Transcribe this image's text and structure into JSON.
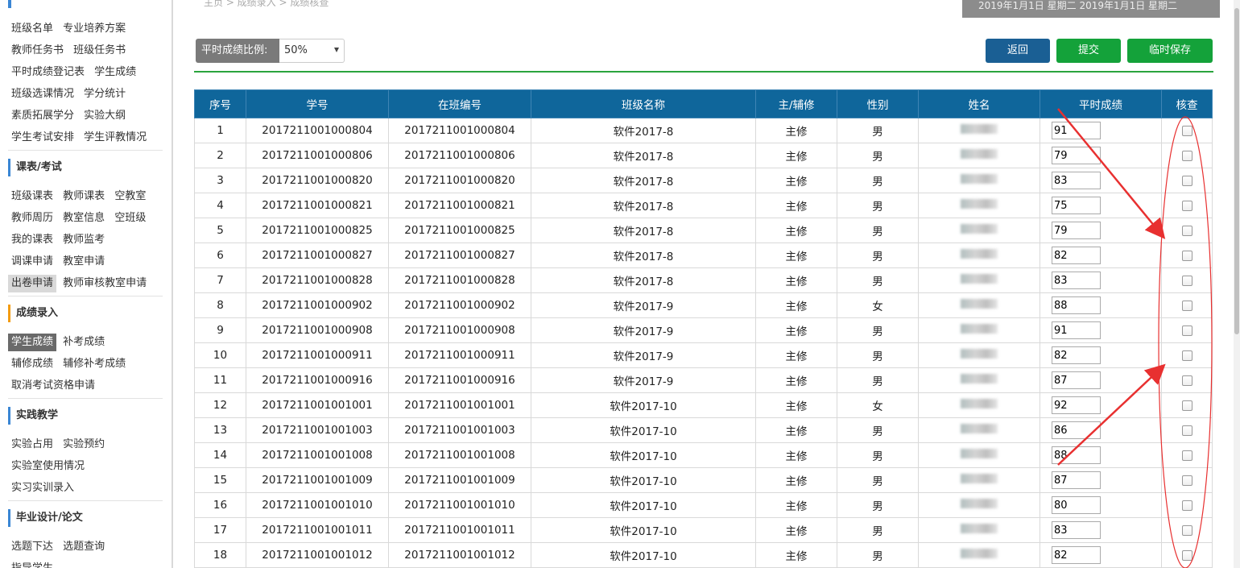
{
  "breadcrumb": "主页 > 成绩录入 > 成绩核查",
  "date_banner": "2019年1月1日 星期二 2019年1月1日 星期二",
  "sidebar": {
    "rows_a": [
      [
        "班级名单",
        "专业培养方案"
      ],
      [
        "教师任务书",
        "班级任务书"
      ],
      [
        "平时成绩登记表",
        "学生成绩"
      ],
      [
        "班级选课情况",
        "学分统计"
      ],
      [
        "素质拓展学分",
        "实验大纲"
      ],
      [
        "学生考试安排",
        "学生评教情况"
      ]
    ],
    "sec_schedule": "课表/考试",
    "rows_b": [
      [
        "班级课表",
        "教师课表",
        "空教室"
      ],
      [
        "教师周历",
        "教室信息",
        "空班级"
      ],
      [
        "我的课表",
        "教师监考"
      ],
      [
        "调课申请",
        "教室申请"
      ],
      [
        "出卷申请",
        "教师审核教室申请"
      ]
    ],
    "sec_grades": "成绩录入",
    "rows_c": [
      [
        "学生成绩",
        "补考成绩"
      ],
      [
        "辅修成绩",
        "辅修补考成绩"
      ],
      [
        "取消考试资格申请"
      ]
    ],
    "sec_practice": "实践教学",
    "rows_d": [
      [
        "实验占用",
        "实验预约"
      ],
      [
        "实验室使用情况"
      ],
      [
        "实习实训录入"
      ]
    ],
    "sec_thesis": "毕业设计/论文",
    "rows_e": [
      [
        "选题下达",
        "选题查询"
      ],
      [
        "指导学生"
      ]
    ]
  },
  "ratio": {
    "label": "平时成绩比例:",
    "value": "50%"
  },
  "buttons": {
    "back": "返回",
    "submit": "提交",
    "save": "临时保存"
  },
  "table": {
    "headers": [
      "序号",
      "学号",
      "在班编号",
      "班级名称",
      "主/辅修",
      "性别",
      "姓名",
      "平时成绩",
      "核查"
    ],
    "rows": [
      [
        "1",
        "2017211001000804",
        "2017211001000804",
        "软件2017-8",
        "主修",
        "男",
        "91"
      ],
      [
        "2",
        "2017211001000806",
        "2017211001000806",
        "软件2017-8",
        "主修",
        "男",
        "79"
      ],
      [
        "3",
        "2017211001000820",
        "2017211001000820",
        "软件2017-8",
        "主修",
        "男",
        "83"
      ],
      [
        "4",
        "2017211001000821",
        "2017211001000821",
        "软件2017-8",
        "主修",
        "男",
        "75"
      ],
      [
        "5",
        "2017211001000825",
        "2017211001000825",
        "软件2017-8",
        "主修",
        "男",
        "79"
      ],
      [
        "6",
        "2017211001000827",
        "2017211001000827",
        "软件2017-8",
        "主修",
        "男",
        "82"
      ],
      [
        "7",
        "2017211001000828",
        "2017211001000828",
        "软件2017-8",
        "主修",
        "男",
        "83"
      ],
      [
        "8",
        "2017211001000902",
        "2017211001000902",
        "软件2017-9",
        "主修",
        "女",
        "88"
      ],
      [
        "9",
        "2017211001000908",
        "2017211001000908",
        "软件2017-9",
        "主修",
        "男",
        "91"
      ],
      [
        "10",
        "2017211001000911",
        "2017211001000911",
        "软件2017-9",
        "主修",
        "男",
        "82"
      ],
      [
        "11",
        "2017211001000916",
        "2017211001000916",
        "软件2017-9",
        "主修",
        "男",
        "87"
      ],
      [
        "12",
        "2017211001001001",
        "2017211001001001",
        "软件2017-10",
        "主修",
        "女",
        "92"
      ],
      [
        "13",
        "2017211001001003",
        "2017211001001003",
        "软件2017-10",
        "主修",
        "男",
        "86"
      ],
      [
        "14",
        "2017211001001008",
        "2017211001001008",
        "软件2017-10",
        "主修",
        "男",
        "88"
      ],
      [
        "15",
        "2017211001001009",
        "2017211001001009",
        "软件2017-10",
        "主修",
        "男",
        "87"
      ],
      [
        "16",
        "2017211001001010",
        "2017211001001010",
        "软件2017-10",
        "主修",
        "男",
        "80"
      ],
      [
        "17",
        "2017211001001011",
        "2017211001001011",
        "软件2017-10",
        "主修",
        "男",
        "83"
      ],
      [
        "18",
        "2017211001001012",
        "2017211001001012",
        "软件2017-10",
        "主修",
        "男",
        "82"
      ]
    ]
  },
  "colors": {
    "header": "#0f669b",
    "primary": "#1a5f94",
    "success": "#14a23a",
    "annotation": "#e83030"
  }
}
